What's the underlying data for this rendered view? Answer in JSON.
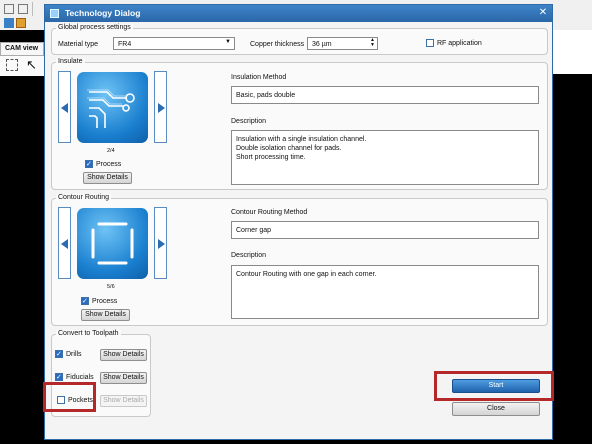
{
  "dialog": {
    "title": "Technology Dialog",
    "close_icon": "close-icon"
  },
  "background_app": {
    "cam_tab_label": "CAM view"
  },
  "global": {
    "group_title": "Global process settings",
    "material_label": "Material type",
    "material_value": "FR4",
    "copper_label": "Copper thickness",
    "copper_value": "36 µm",
    "rf_label": "RF application",
    "rf_checked": false
  },
  "insulate": {
    "group_title": "Insulate",
    "page_indicator": "2/4",
    "process_label": "Process",
    "process_checked": true,
    "show_details_label": "Show Details",
    "method_heading": "Insulation Method",
    "method_value": "Basic, pads double",
    "description_heading": "Description",
    "description_line1": "Insulation with a single insulation channel.",
    "description_line2": "Double isolation channel for pads.",
    "description_line3": "Short processing time."
  },
  "contour": {
    "group_title": "Contour Routing",
    "page_indicator": "5/6",
    "process_label": "Process",
    "process_checked": true,
    "show_details_label": "Show Details",
    "method_heading": "Contour Routing Method",
    "method_value": "Corner gap",
    "description_heading": "Description",
    "description_line1": "Contour Routing with one gap in each corner."
  },
  "toolpath": {
    "group_title": "Convert to Toolpath",
    "drills_label": "Drills",
    "drills_checked": true,
    "fiducials_label": "Fiducials",
    "fiducials_checked": true,
    "pockets_label": "Pockets",
    "pockets_checked": false,
    "show_details_label": "Show Details"
  },
  "actions": {
    "start_label": "Start",
    "close_label": "Close"
  },
  "colors": {
    "title_bar": "#2f6aa8",
    "highlight": "#b5282a",
    "accent": "#1a7fcf"
  }
}
